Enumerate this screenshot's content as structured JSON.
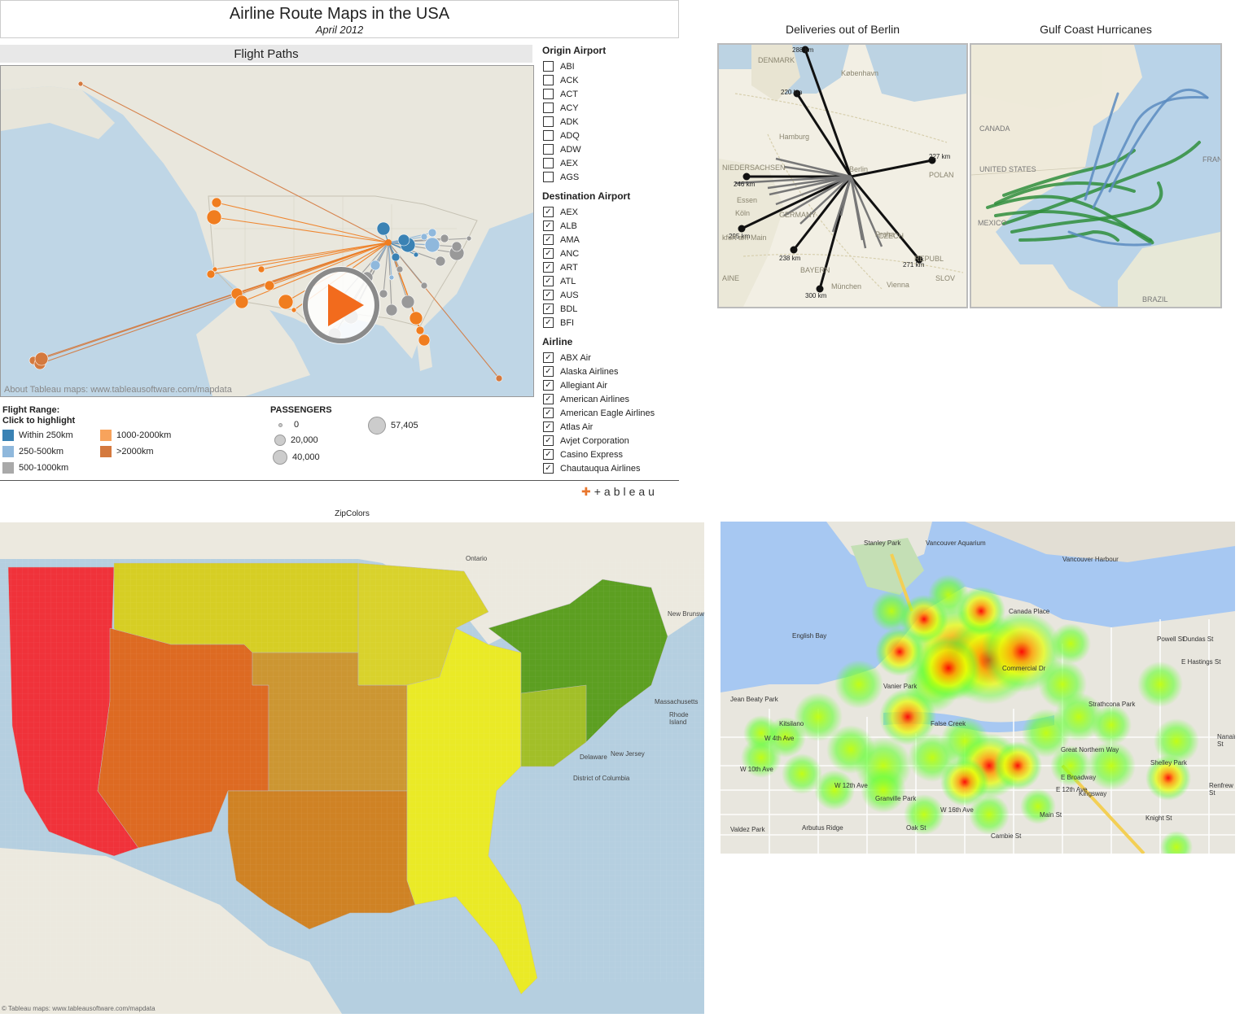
{
  "dashboard": {
    "title": "Airline Route Maps in the USA",
    "subtitle": "April 2012",
    "panel_title": "Flight Paths",
    "map_credit": "About Tableau maps: www.tableausoftware.com/mapdata",
    "play_icon": "play-icon",
    "flight_range": {
      "title_line1": "Flight Range:",
      "title_line2": "Click to highlight",
      "items": [
        {
          "label": "Within 250km",
          "color": "#3a82b4"
        },
        {
          "label": "250-500km",
          "color": "#8fb8dc"
        },
        {
          "label": "500-1000km",
          "color": "#a9a9a9"
        },
        {
          "label": "1000-2000km",
          "color": "#f7a35c"
        },
        {
          "label": ">2000km",
          "color": "#d4793e"
        }
      ]
    },
    "passengers": {
      "title": "PASSENGERS",
      "items": [
        "0",
        "20,000",
        "40,000",
        "57,405"
      ]
    },
    "origin_airport": {
      "title": "Origin Airport",
      "items": [
        "ABI",
        "ACK",
        "ACT",
        "ACY",
        "ADK",
        "ADQ",
        "ADW",
        "AEX",
        "AGS"
      ],
      "checked": false
    },
    "destination_airport": {
      "title": "Destination Airport",
      "items": [
        "AEX",
        "ALB",
        "AMA",
        "ANC",
        "ART",
        "ATL",
        "AUS",
        "BDL",
        "BFI"
      ],
      "checked": true
    },
    "airline": {
      "title": "Airline",
      "items": [
        "ABX Air",
        "Alaska Airlines",
        "Allegiant Air",
        "American Airlines",
        "American Eagle Airlines",
        "Atlas Air",
        "Avjet Corporation",
        "Casino Express",
        "Chautauqua Airlines"
      ],
      "checked": true
    },
    "logo": "+ableau"
  },
  "berlin": {
    "title": "Deliveries out of Berlin",
    "labels": [
      "288 km",
      "220 km",
      "227 km",
      "246 km",
      "295 km",
      "238 km",
      "271 km",
      "300 km"
    ],
    "places": [
      "DENMARK",
      "København",
      "Hamburg",
      "NIEDERSACHSEN",
      "Essen",
      "Köln",
      "GERMANY",
      "POLAN",
      "Berlin",
      "CZECH",
      "REPUBL",
      "BAYERN",
      "München",
      "Vienna",
      "SLOV",
      "Praha",
      "kfurt am Main",
      "AINE"
    ]
  },
  "hurricanes": {
    "title": "Gulf Coast Hurricanes",
    "places": [
      "CANADA",
      "UNITED STATES",
      "MEXICO",
      "BRAZIL",
      "FRAN"
    ]
  },
  "zip": {
    "title": "ZipColors",
    "credit": "© Tableau maps: www.tableausoftware.com/mapdata",
    "places": [
      "Ontario",
      "New Brunsw",
      "Massachusetts",
      "Rhode Island",
      "New Jersey",
      "District of Columbia",
      "Delaware"
    ]
  },
  "vancouver": {
    "places": [
      "Stanley Park",
      "Vancouver Aquarium",
      "Vancouver Harbour",
      "English Bay",
      "Canada Place",
      "Vanier Park",
      "Jean Beaty Park",
      "Kitsilano",
      "False Creek",
      "Strathcona Park",
      "Shelley Park",
      "Granville Park",
      "Valdez Park",
      "Arbutus Ridge",
      "Great Northern Way",
      "Powell St",
      "Dundas St",
      "E Hastings St",
      "E Broadway",
      "W 4th Ave",
      "W 10th Ave",
      "W 12th Ave",
      "W 16th Ave",
      "E 12th Ave",
      "Kingsway",
      "Oak St",
      "Cambie St",
      "Main St",
      "Nanaimo St",
      "Knight St",
      "Commercial Dr",
      "Renfrew St"
    ]
  }
}
